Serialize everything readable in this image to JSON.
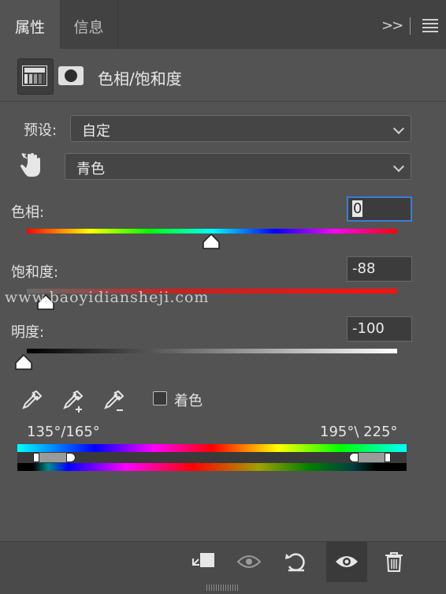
{
  "tabs": [
    {
      "label": "属性",
      "active": true
    },
    {
      "label": "信息",
      "active": false
    }
  ],
  "panel_menu": {
    "collapse_icon": "double-chevron-right-icon",
    "menu_icon": "hamburger-menu-icon"
  },
  "adjustment": {
    "title": "色相/饱和度",
    "icon": "hue-saturation-icon",
    "mask_icon": "layer-mask-icon"
  },
  "preset": {
    "label": "预设:",
    "value": "自定"
  },
  "channel": {
    "value": "青色",
    "icon": "target-adjust-hand-icon"
  },
  "hue": {
    "label": "色相:",
    "value": "0",
    "min": -180,
    "max": 180
  },
  "saturation": {
    "label": "饱和度:",
    "value": "-88",
    "min": -100,
    "max": 100
  },
  "lightness": {
    "label": "明度:",
    "value": "-100",
    "min": -100,
    "max": 100
  },
  "watermark": "www.baoyidiansheji.com",
  "eyedroppers": [
    "eyedropper-icon",
    "eyedropper-add-icon",
    "eyedropper-subtract-icon"
  ],
  "colorize": {
    "label": "着色",
    "checked": false
  },
  "range": {
    "left": "135°/165°",
    "right": "195°\\ 225°"
  },
  "bottom_toolbar": [
    "clip-to-layer-icon",
    "view-previous-state-icon",
    "reset-icon",
    "toggle-visibility-icon",
    "delete-icon"
  ],
  "colors": {
    "panel_bg": "#535353",
    "focus_border": "#3b7cd9",
    "text": "#e6e6e6"
  }
}
